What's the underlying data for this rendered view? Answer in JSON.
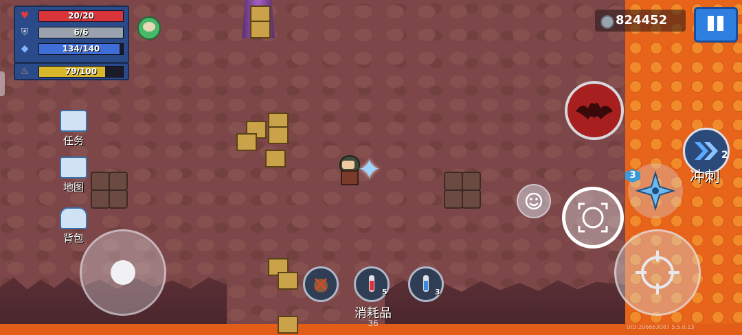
{
  "hud": {
    "hp_text": "20/20",
    "hp_value": 20,
    "hp_max": 20,
    "armor_text": "6/6",
    "armor_value": 6,
    "armor_max": 6,
    "energy_text": "134/140",
    "energy_value": 134,
    "energy_max": 140,
    "hunger_text": "79/100",
    "hunger_value": 79,
    "hunger_max": 100,
    "colors": {
      "hp": "#d8343a",
      "armor": "#9aa3ad",
      "energy": "#3f6ed8",
      "hunger": "#d8b82a"
    }
  },
  "side_menu": [
    {
      "label": "任务",
      "icon": "quest-icon"
    },
    {
      "label": "地图",
      "icon": "map-icon"
    },
    {
      "label": "背包",
      "icon": "backpack-icon"
    }
  ],
  "currency": {
    "amount": "824452",
    "icon": "gem-coin-icon"
  },
  "buttons": {
    "pause_icon": "pause-icon",
    "skill_icon": "bat-skill-icon",
    "emote_icon": "smiley-icon",
    "aim_icon": "crosshair-icon",
    "fire_icon": "fire-crosshair-icon",
    "weapon_icon": "shuriken-icon",
    "weapon_count": "3",
    "dash_label": "冲刺",
    "dash_count": "2",
    "dash_icon": "dash-chevrons-icon"
  },
  "consumables": {
    "label": "消耗品",
    "total": "36",
    "items": [
      {
        "icon": "disabled-bomb-icon",
        "count": ""
      },
      {
        "icon": "red-potion-icon",
        "count": "5"
      },
      {
        "icon": "blue-potion-icon",
        "count": "3"
      }
    ]
  },
  "uid_text": "UID:206663087 5.5.0.13"
}
